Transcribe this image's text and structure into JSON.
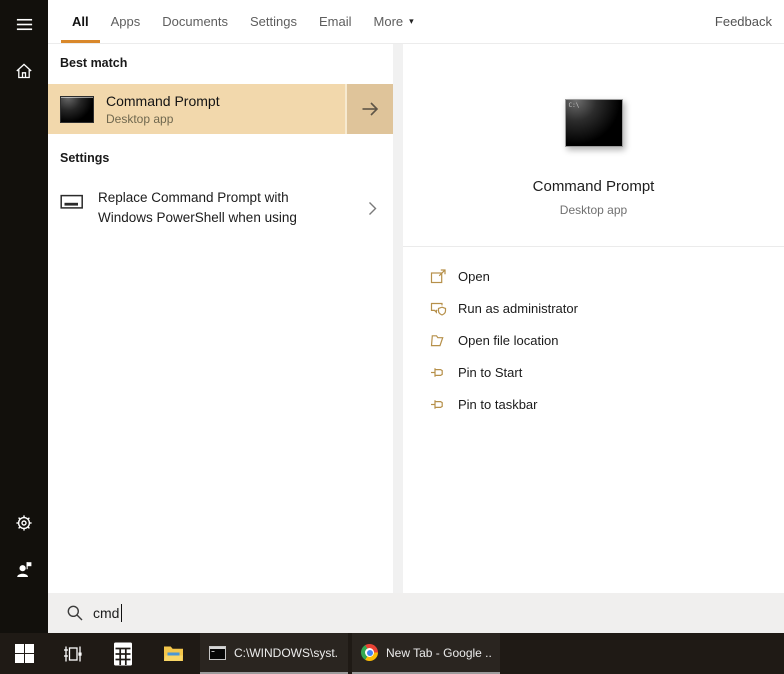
{
  "topbar": {
    "tabs": [
      {
        "label": "All",
        "active": true
      },
      {
        "label": "Apps"
      },
      {
        "label": "Documents"
      },
      {
        "label": "Settings"
      },
      {
        "label": "Email"
      },
      {
        "label": "More",
        "caret": "▾"
      }
    ],
    "feedback": "Feedback"
  },
  "left_panel": {
    "best_match_header": "Best match",
    "best_match": {
      "title": "Command Prompt",
      "subtitle": "Desktop app"
    },
    "settings_header": "Settings",
    "settings_item": {
      "line1": "Replace Command Prompt with",
      "line2": "Windows PowerShell when using"
    }
  },
  "right_panel": {
    "icon_glyph": "C:\\",
    "title": "Command Prompt",
    "subtitle": "Desktop app",
    "actions": [
      {
        "icon": "open-icon",
        "label": "Open"
      },
      {
        "icon": "run-as-admin-icon",
        "label": "Run as administrator"
      },
      {
        "icon": "file-location-icon",
        "label": "Open file location"
      },
      {
        "icon": "pin-icon",
        "label": "Pin to Start"
      },
      {
        "icon": "pin-icon",
        "label": "Pin to taskbar"
      }
    ]
  },
  "search": {
    "value": "cmd"
  },
  "taskbar": {
    "buttons": [
      {
        "icon": "cmd-window-icon",
        "label": "C:\\WINDOWS\\syst..."
      },
      {
        "icon": "chrome-icon",
        "label": "New Tab - Google ..."
      }
    ]
  },
  "colors": {
    "accent": "#d9882b",
    "highlight": "#f2d8ac",
    "highlight_dark": "#dfc49a",
    "action_icon": "#b6904a",
    "taskbar_bg": "#1f1a15"
  }
}
